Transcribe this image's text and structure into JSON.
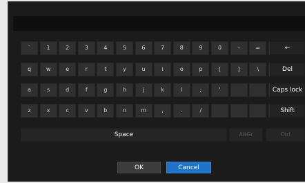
{
  "keyboard": {
    "row1": [
      "`",
      "1",
      "2",
      "3",
      "4",
      "5",
      "6",
      "7",
      "8",
      "9",
      "0",
      "–",
      "=",
      "",
      "←"
    ],
    "row2": [
      "q",
      "w",
      "e",
      "r",
      "t",
      "y",
      "u",
      "i",
      "o",
      "p",
      "[",
      "]",
      "\\",
      "",
      "Del"
    ],
    "row3": [
      "a",
      "s",
      "d",
      "f",
      "g",
      "h",
      "j",
      "k",
      "l",
      ";",
      "'",
      "",
      "",
      "",
      "Caps lock"
    ],
    "row4": [
      "z",
      "x",
      "c",
      "v",
      "b",
      "n",
      "m",
      ",",
      ".",
      "/",
      "",
      "",
      "",
      "",
      "Shift"
    ],
    "space_label": "Space",
    "altgr_label": "AltGr",
    "ctrl_label": "Ctrl"
  },
  "actions": {
    "ok_label": "OK",
    "cancel_label": "Cancel"
  },
  "colors": {
    "background": "#1b1b1b",
    "key": "#303030",
    "accent": "#1e73c8"
  }
}
